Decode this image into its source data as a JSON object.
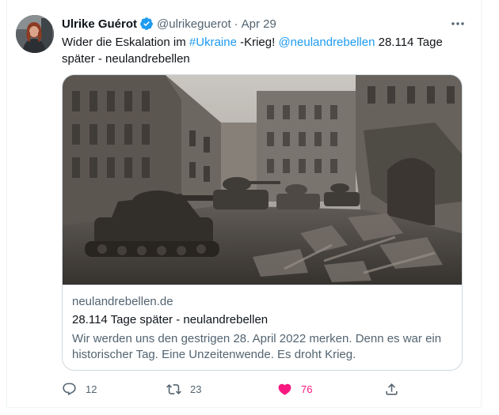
{
  "tweet": {
    "author_name": "Ulrike Guérot",
    "handle": "@ulrikeguerot",
    "separator": "·",
    "date": "Apr 29",
    "text_1": "Wider die Eskalation im ",
    "hashtag": "#Ukraine",
    "text_2": " -Krieg! ",
    "mention": "@neulandrebellen",
    "text_3": " 28.114 Tage später - neulandrebellen"
  },
  "card": {
    "domain": "neulandrebellen.de",
    "title": "28.114 Tage später - neulandrebellen",
    "description": "Wir werden uns den gestrigen 28. April 2022 merken. Denn es war ein historischer Tag. Eine Unzeitenwende. Es droht Krieg."
  },
  "actions": {
    "reply_count": "12",
    "retweet_count": "23",
    "like_count": "76"
  },
  "icons": {
    "verified": "verified-badge-icon",
    "more": "more-dots-icon",
    "reply": "reply-icon",
    "retweet": "retweet-icon",
    "like": "heart-filled-icon",
    "share": "share-icon"
  },
  "colors": {
    "link": "#1d9bf0",
    "like": "#f91880",
    "secondary_text": "#536471"
  }
}
